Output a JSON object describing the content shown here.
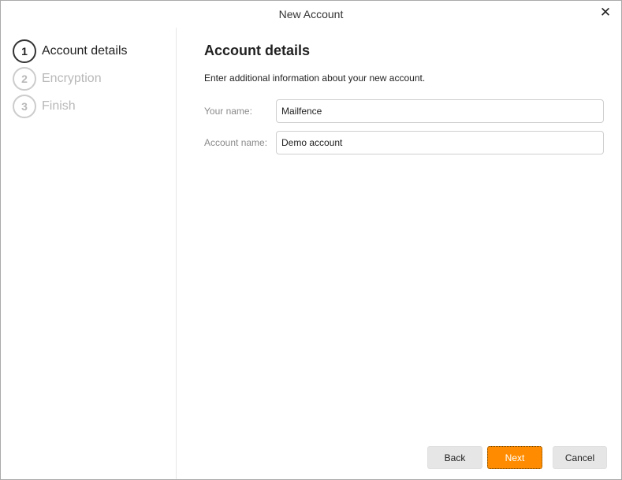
{
  "window": {
    "title": "New Account",
    "close_symbol": "✕"
  },
  "steps": [
    {
      "number": "1",
      "label": "Account details",
      "state": "active"
    },
    {
      "number": "2",
      "label": "Encryption",
      "state": "pending"
    },
    {
      "number": "3",
      "label": "Finish",
      "state": "pending"
    }
  ],
  "main": {
    "heading": "Account details",
    "intro": "Enter additional information about your new account.",
    "fields": {
      "your_name": {
        "label": "Your name:",
        "value": "Mailfence"
      },
      "account_name": {
        "label": "Account name:",
        "value": "Demo account"
      }
    }
  },
  "buttons": {
    "back": "Back",
    "next": "Next",
    "cancel": "Cancel"
  },
  "colors": {
    "accent": "#ff8c00",
    "inactive_step": "#b8b8b8"
  }
}
